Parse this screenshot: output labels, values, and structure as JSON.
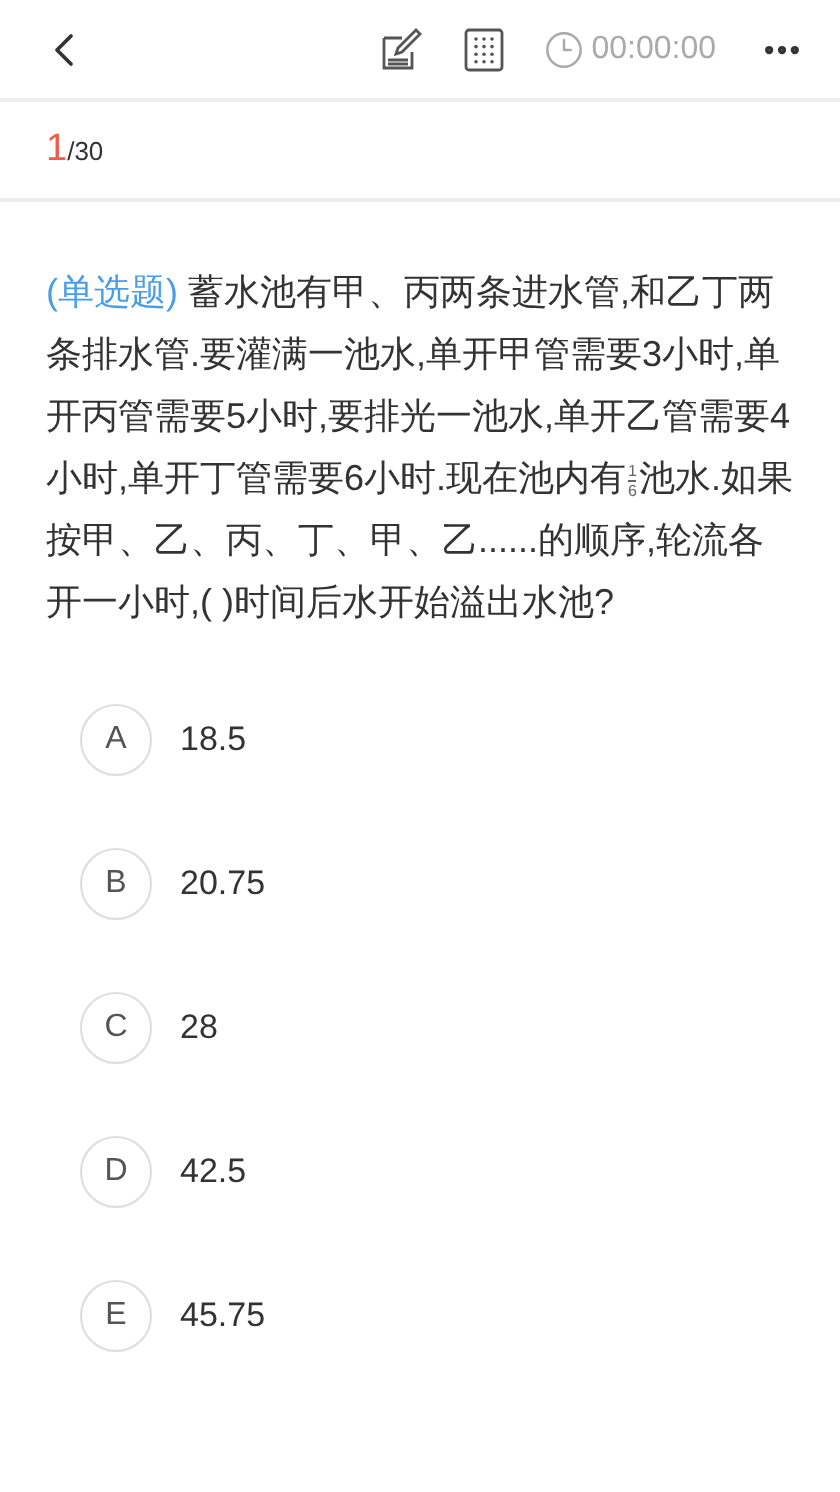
{
  "header": {
    "timer": "00:00:00"
  },
  "progress": {
    "current": "1",
    "total": "/30"
  },
  "question": {
    "type": "(单选题)",
    "before": " 蓄水池有甲、丙两条进水管,和乙丁两条排水管.要灌满一池水,单开甲管需要3小时,单开丙管需要5小时,要排光一池水,单开乙管需要4小时,单开丁管需要6小时.现在池内有",
    "fraction": {
      "numerator": "1",
      "denominator": "6"
    },
    "after": "池水.如果按甲、乙、丙、丁、甲、乙......的顺序,轮流各开一小时,( )时间后水开始溢出水池?"
  },
  "options": [
    {
      "letter": "A",
      "text": "18.5",
      "selected": false
    },
    {
      "letter": "B",
      "text": "20.75",
      "selected": false
    },
    {
      "letter": "C",
      "text": "28",
      "selected": false
    },
    {
      "letter": "D",
      "text": "42.5",
      "selected": false
    },
    {
      "letter": "E",
      "text": "45.75",
      "selected": false
    }
  ]
}
